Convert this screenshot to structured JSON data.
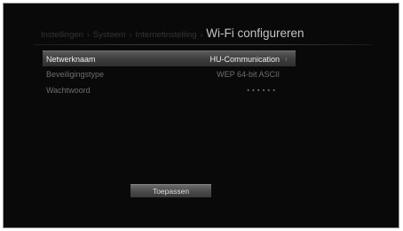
{
  "breadcrumb": {
    "items": [
      "Instellingen",
      "Systeem",
      "Internetinstelling"
    ],
    "separator": "›",
    "current": "Wi-Fi configureren"
  },
  "settings": [
    {
      "label": "Netwerknaam",
      "value": "HU-Communication",
      "selected": true,
      "has_chevron": true
    },
    {
      "label": "Beveiligingstype",
      "value": "WEP 64-bit ASCII",
      "selected": false,
      "has_chevron": false
    },
    {
      "label": "Wachtwoord",
      "value": "••••••",
      "selected": false,
      "has_chevron": false
    }
  ],
  "chevron_icon": "chevron-right-icon",
  "chevron_glyph": "›",
  "apply_button": {
    "label": "Toepassen"
  },
  "colors": {
    "background": "#090909",
    "selected_row": "#4a4a4a",
    "text_primary": "#f0f0f0",
    "text_dim": "#6e6e6e",
    "breadcrumb_dim": "#353535"
  }
}
